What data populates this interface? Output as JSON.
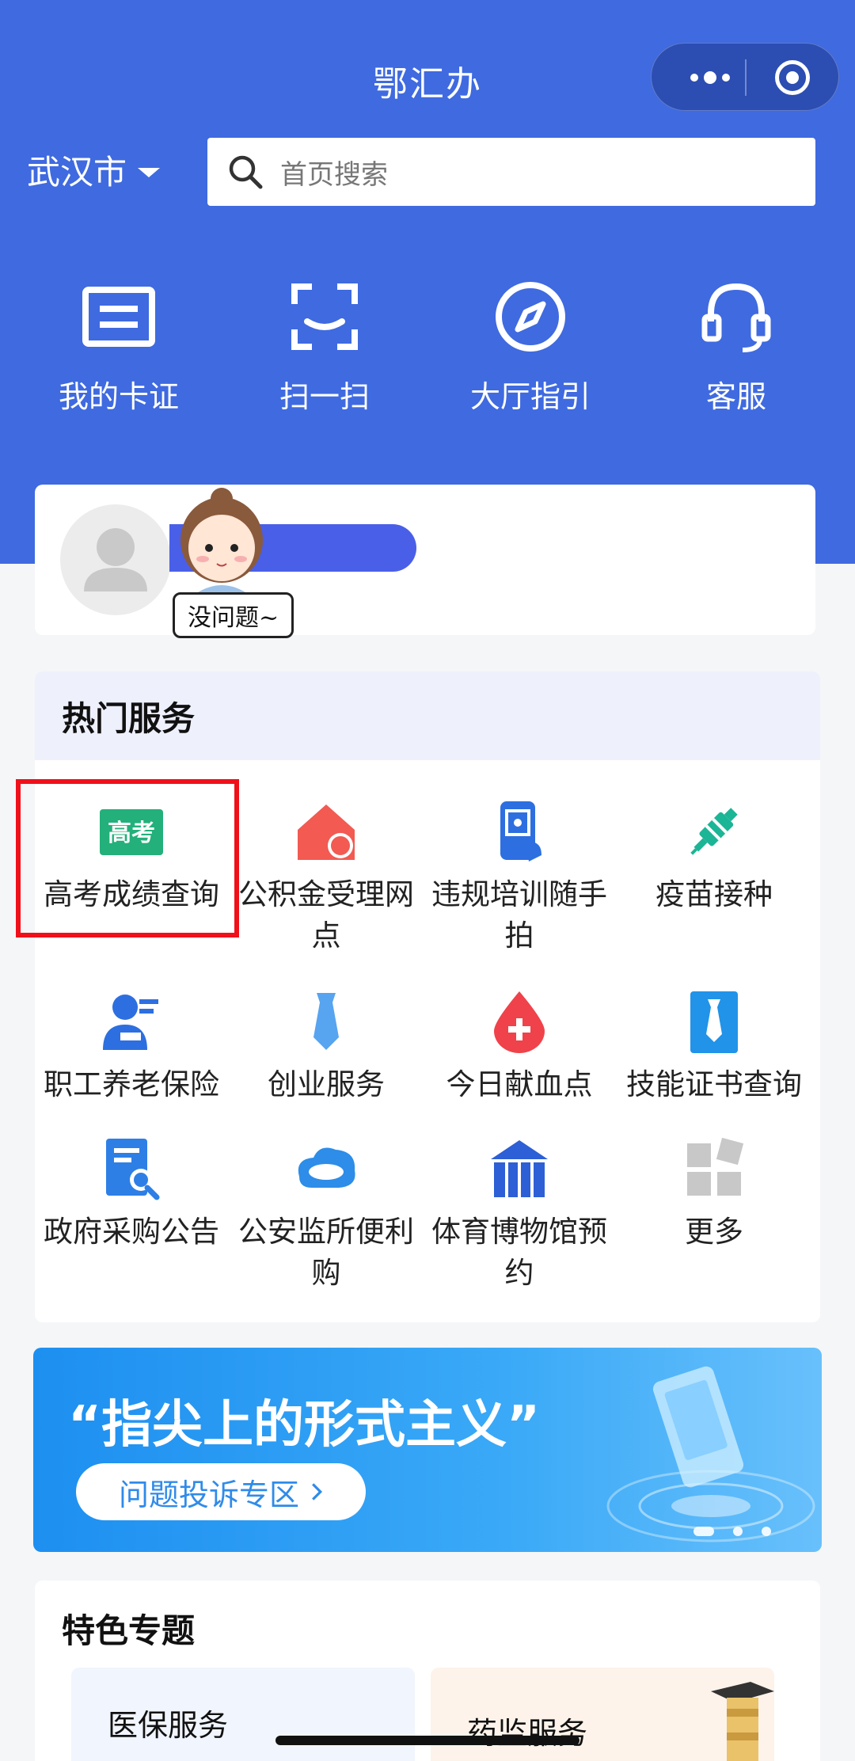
{
  "header": {
    "title": "鄂汇办"
  },
  "city": {
    "name": "武汉市"
  },
  "search": {
    "placeholder": "首页搜索"
  },
  "quick_actions": [
    {
      "label": "我的卡证",
      "icon": "card-icon"
    },
    {
      "label": "扫一扫",
      "icon": "scan-icon"
    },
    {
      "label": "大厅指引",
      "icon": "compass-icon"
    },
    {
      "label": "客服",
      "icon": "headset-icon"
    }
  ],
  "profile": {
    "sticker_text": "没问题~"
  },
  "hot_services": {
    "title": "热门服务",
    "items": [
      {
        "label": "高考成绩查询",
        "icon": "gaokao-icon",
        "icon_text": "高考"
      },
      {
        "label": "公积金受理网点",
        "icon": "house-location-icon"
      },
      {
        "label": "违规培训随手拍",
        "icon": "phone-camera-icon"
      },
      {
        "label": "疫苗接种",
        "icon": "syringe-icon"
      },
      {
        "label": "职工养老保险",
        "icon": "worker-icon"
      },
      {
        "label": "创业服务",
        "icon": "tie-icon"
      },
      {
        "label": "今日献血点",
        "icon": "blood-drop-icon"
      },
      {
        "label": "技能证书查询",
        "icon": "certificate-icon"
      },
      {
        "label": "政府采购公告",
        "icon": "document-search-icon"
      },
      {
        "label": "公安监所便利购",
        "icon": "cloud-icon"
      },
      {
        "label": "体育博物馆预约",
        "icon": "museum-icon"
      },
      {
        "label": "更多",
        "icon": "more-grid-icon"
      }
    ]
  },
  "banner": {
    "title": "“指尖上的形式主义”",
    "button_label": "问题投诉专区"
  },
  "special_topics": {
    "title": "特色专题",
    "cards": [
      {
        "label": "医保服务"
      },
      {
        "label": "药监服务"
      }
    ]
  },
  "colors": {
    "brand_blue": "#3f6ae0",
    "highlight_red": "#f0101a",
    "banner_blue": "#1d8ff0"
  }
}
